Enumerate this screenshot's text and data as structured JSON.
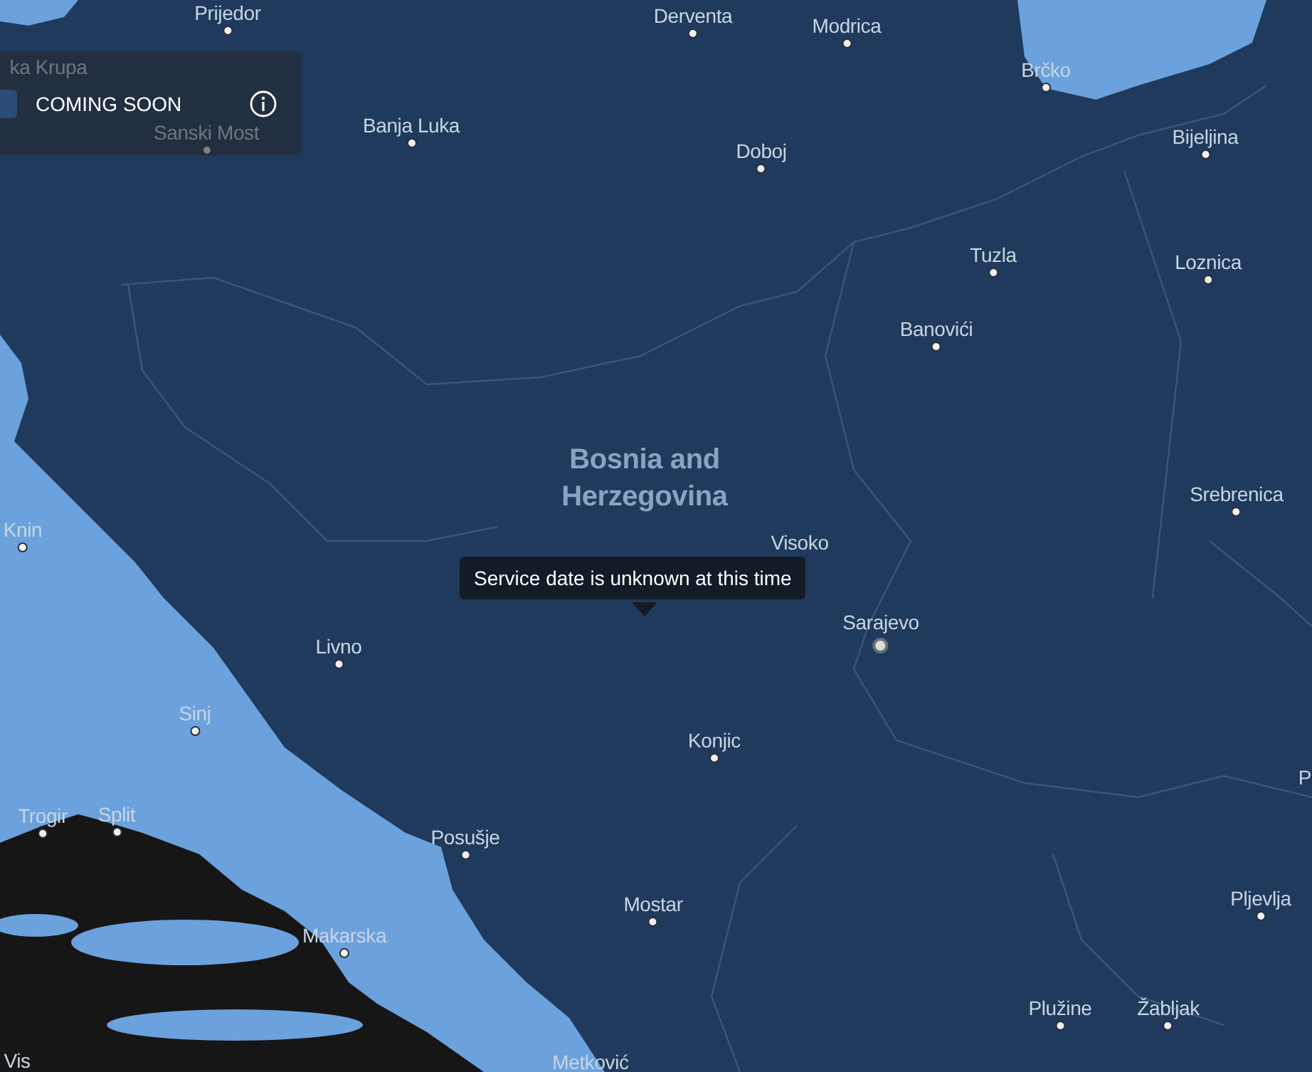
{
  "map": {
    "places": [
      {
        "name": "Prijedor",
        "kind": "town"
      },
      {
        "name": "Derventa",
        "kind": "town"
      },
      {
        "name": "Modrica",
        "kind": "town"
      },
      {
        "name": "Brčko",
        "kind": "town"
      },
      {
        "name": "ka Krupa",
        "kind": "label"
      },
      {
        "name": "Sanski Most",
        "kind": "town"
      },
      {
        "name": "Banja Luka",
        "kind": "town"
      },
      {
        "name": "Doboj",
        "kind": "town"
      },
      {
        "name": "Bijeljina",
        "kind": "town"
      },
      {
        "name": "Tuzla",
        "kind": "town"
      },
      {
        "name": "Loznica",
        "kind": "town"
      },
      {
        "name": "Banovići",
        "kind": "town"
      },
      {
        "name": "Bosnia and Herzegovina",
        "kind": "country"
      },
      {
        "name": "Srebrenica",
        "kind": "town"
      },
      {
        "name": "Knin",
        "kind": "town"
      },
      {
        "name": "Visoko",
        "kind": "label"
      },
      {
        "name": "Sarajevo",
        "kind": "capital"
      },
      {
        "name": "Livno",
        "kind": "town"
      },
      {
        "name": "Sinj",
        "kind": "town"
      },
      {
        "name": "Konjic",
        "kind": "town"
      },
      {
        "name": "P",
        "kind": "label"
      },
      {
        "name": "Trogir",
        "kind": "town"
      },
      {
        "name": "Split",
        "kind": "town"
      },
      {
        "name": "Posušje",
        "kind": "town"
      },
      {
        "name": "Mostar",
        "kind": "town"
      },
      {
        "name": "Pljevlja",
        "kind": "town"
      },
      {
        "name": "Makarska",
        "kind": "town"
      },
      {
        "name": "Plužine",
        "kind": "town"
      },
      {
        "name": "Žabljak",
        "kind": "town"
      },
      {
        "name": "Vis",
        "kind": "label"
      },
      {
        "name": "Metković",
        "kind": "label"
      }
    ]
  },
  "legend": {
    "label": "COMING SOON"
  },
  "tooltip": {
    "text": "Service date is unknown at this time"
  }
}
